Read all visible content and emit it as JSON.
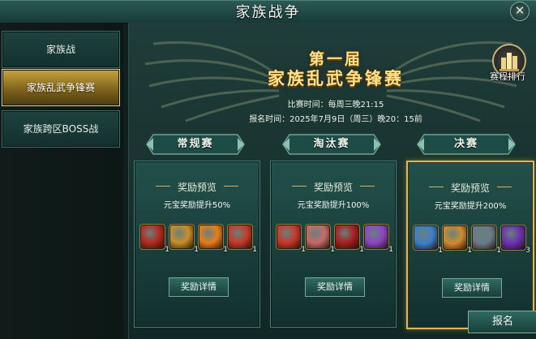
{
  "window": {
    "title": "家族战争",
    "close_symbol": "✕"
  },
  "sidebar": {
    "items": [
      {
        "label": "家族战",
        "active": false
      },
      {
        "label": "家族乱武争锋赛",
        "active": true
      },
      {
        "label": "家族跨区BOSS战",
        "active": false
      }
    ]
  },
  "banner": {
    "edition": "第一届",
    "name": "家族乱武争锋赛"
  },
  "schedule": {
    "match_time": "比赛时间：每周三晚21:15",
    "signup_time": "报名时间：2025年7月9日（周三）晚20：15前"
  },
  "ranking_button": {
    "label": "赛程排行",
    "icon": "ranking-bars-icon"
  },
  "stages": [
    {
      "tab_label": "常规赛",
      "card_title": "奖励预览",
      "bonus": "元宝奖励提升50%",
      "detail_button": "奖励详情",
      "highlighted": false,
      "items": [
        {
          "icon": "red-token-icon",
          "count": "1",
          "color": "#b5291e"
        },
        {
          "icon": "gold-treasure-icon",
          "count": "1",
          "color": "#c98f28"
        },
        {
          "icon": "flame-orb-icon",
          "count": "1",
          "color": "#e87d1a"
        },
        {
          "icon": "treasure-chest-icon",
          "count": "1",
          "color": "#c7392a"
        }
      ]
    },
    {
      "tab_label": "淘汰赛",
      "card_title": "奖励预览",
      "bonus": "元宝奖励提升100%",
      "detail_button": "奖励详情",
      "highlighted": false,
      "items": [
        {
          "icon": "treasure-chest-icon",
          "count": "1",
          "color": "#c7392a"
        },
        {
          "icon": "pink-orb-icon",
          "count": "1",
          "color": "#c76a6a"
        },
        {
          "icon": "red-scroll-icon",
          "count": "1",
          "color": "#a81f1f"
        },
        {
          "icon": "purple-crystal-icon",
          "count": "1",
          "color": "#8c45c4"
        }
      ]
    },
    {
      "tab_label": "决赛",
      "card_title": "奖励预览",
      "bonus": "元宝奖励提升200%",
      "detail_button": "奖励详情",
      "highlighted": true,
      "items": [
        {
          "icon": "blue-wand-icon",
          "count": "1",
          "color": "#3c7fc9"
        },
        {
          "icon": "fire-token-icon",
          "count": "1",
          "color": "#d48a2c"
        },
        {
          "icon": "silver-claw-icon",
          "count": "1",
          "color": "#6c7b88"
        },
        {
          "icon": "purple-gem-icon",
          "count": "3",
          "color": "#6c2fb0"
        }
      ]
    }
  ],
  "signup_button": {
    "label": "报名"
  }
}
